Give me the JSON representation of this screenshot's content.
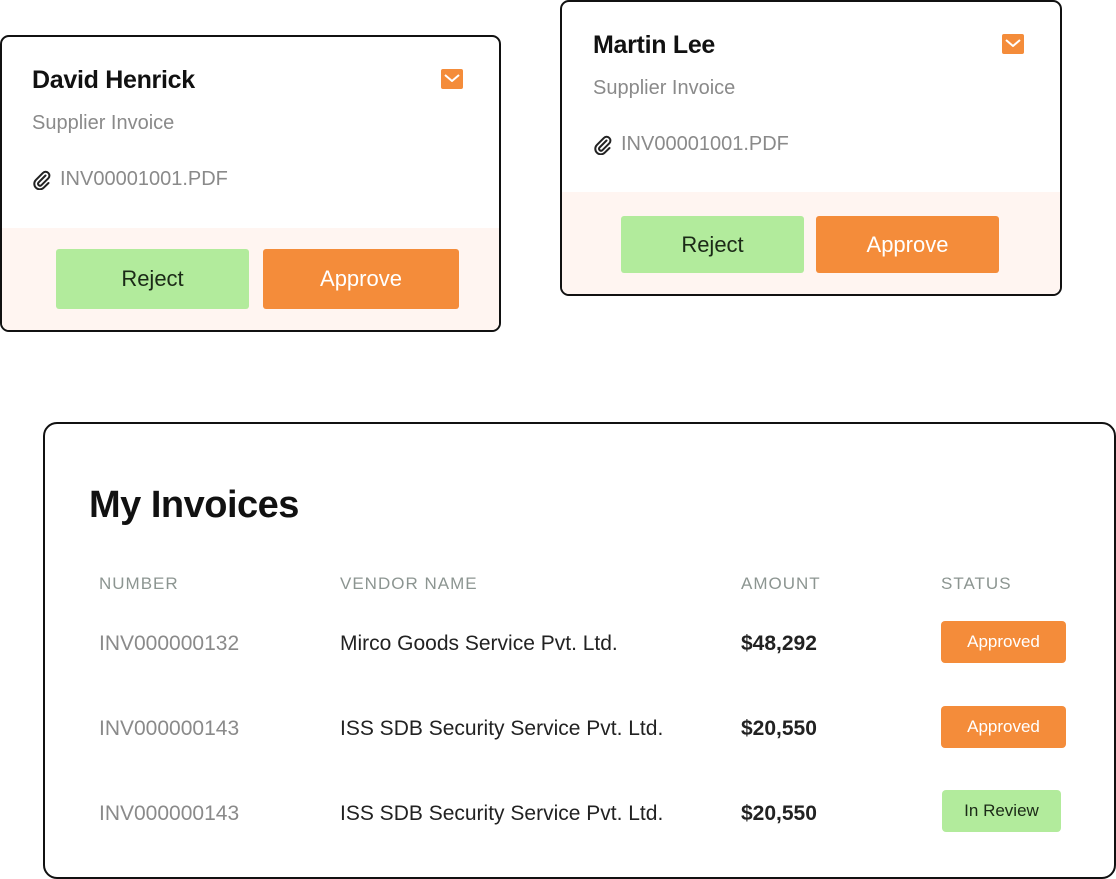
{
  "cards": [
    {
      "name": "David Henrick",
      "subtitle": "Supplier Invoice",
      "attachment": "INV00001001.PDF",
      "reject_label": "Reject",
      "approve_label": "Approve",
      "mail_icon": "mail-icon",
      "attachment_icon": "paperclip-icon"
    },
    {
      "name": "Martin Lee",
      "subtitle": "Supplier Invoice",
      "attachment": "INV00001001.PDF",
      "reject_label": "Reject",
      "approve_label": "Approve",
      "mail_icon": "mail-icon",
      "attachment_icon": "paperclip-icon"
    }
  ],
  "invoices": {
    "title": "My Invoices",
    "columns": [
      "NUMBER",
      "VENDOR NAME",
      "AMOUNT",
      "STATUS"
    ],
    "rows": [
      {
        "number": "INV000000132",
        "vendor": "Mirco Goods Service Pvt. Ltd.",
        "amount": "$48,292",
        "status": "Approved"
      },
      {
        "number": "INV000000143",
        "vendor": "ISS SDB Security Service Pvt. Ltd.",
        "amount": "$20,550",
        "status": "Approved"
      },
      {
        "number": "INV000000143",
        "vendor": "ISS SDB Security Service Pvt. Ltd.",
        "amount": "$20,550",
        "status": "In Review"
      }
    ]
  },
  "colors": {
    "accent_orange": "#f48c3a",
    "accent_green": "#b2eb9c",
    "footer_tint": "#fff5f1",
    "border": "#111111"
  }
}
